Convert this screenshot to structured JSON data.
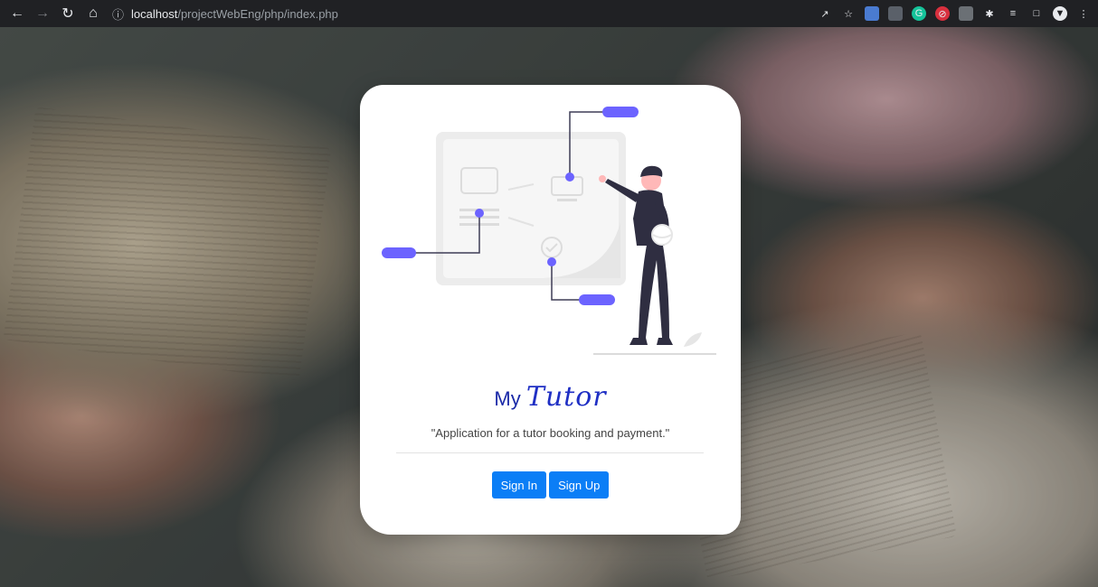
{
  "browser": {
    "url_host": "localhost",
    "url_path": "/projectWebEng/php/index.php",
    "nav_icons": [
      "back-arrow-icon",
      "forward-arrow-icon",
      "reload-icon",
      "home-icon"
    ],
    "extension_icons": [
      "share-icon",
      "bookmark-star-icon",
      "translate-icon",
      "extension-icon",
      "grammarly-icon",
      "block-icon",
      "camera-icon",
      "puzzle-icon",
      "reading-list-icon",
      "side-panel-icon",
      "profile-icon",
      "menu-icon"
    ]
  },
  "card": {
    "logo_prefix": "My",
    "logo_script": "Tutor",
    "tagline": "\"Application for a tutor booking and payment.\"",
    "sign_in_label": "Sign In",
    "sign_up_label": "Sign Up"
  },
  "colors": {
    "accent": "#6c63ff",
    "button": "#0b7ef6",
    "logo": "#1b2aa8"
  }
}
